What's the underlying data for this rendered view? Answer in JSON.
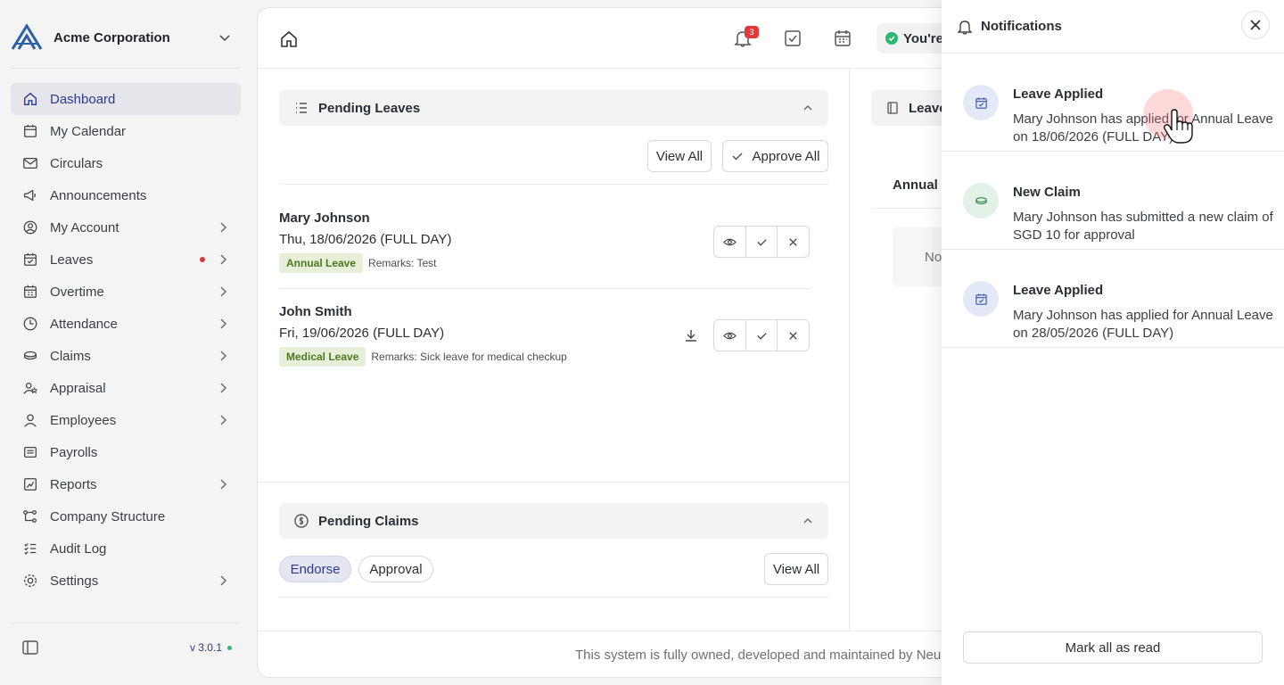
{
  "sidebar": {
    "org_name": "Acme Corporation",
    "version": "v 3.0.1",
    "items": [
      {
        "label": "Dashboard",
        "icon": "home-icon",
        "active": true,
        "chevron": false
      },
      {
        "label": "My Calendar",
        "icon": "calendar-icon",
        "chevron": false
      },
      {
        "label": "Circulars",
        "icon": "mail-icon",
        "chevron": false
      },
      {
        "label": "Announcements",
        "icon": "megaphone-icon",
        "chevron": false
      },
      {
        "label": "My Account",
        "icon": "user-circle-icon",
        "chevron": true
      },
      {
        "label": "Leaves",
        "icon": "calendar-check-icon",
        "chevron": true,
        "dot": true
      },
      {
        "label": "Overtime",
        "icon": "calendar-clock-icon",
        "chevron": true
      },
      {
        "label": "Attendance",
        "icon": "clock-icon",
        "chevron": true
      },
      {
        "label": "Claims",
        "icon": "coins-icon",
        "chevron": true
      },
      {
        "label": "Appraisal",
        "icon": "user-star-icon",
        "chevron": true
      },
      {
        "label": "Employees",
        "icon": "user-icon",
        "chevron": true
      },
      {
        "label": "Payrolls",
        "icon": "receipt-icon",
        "chevron": false
      },
      {
        "label": "Reports",
        "icon": "chart-icon",
        "chevron": true
      },
      {
        "label": "Company Structure",
        "icon": "hierarchy-icon",
        "chevron": false
      },
      {
        "label": "Audit Log",
        "icon": "list-check-icon",
        "chevron": false
      },
      {
        "label": "Settings",
        "icon": "gear-icon",
        "chevron": true
      }
    ]
  },
  "topbar": {
    "notification_count": "3",
    "status_text": "You're"
  },
  "pending_leaves": {
    "title": "Pending Leaves",
    "view_all": "View All",
    "approve_all": "Approve All",
    "items": [
      {
        "name": "Mary Johnson",
        "date": "Thu, 18/06/2026 (FULL DAY)",
        "type": "Annual Leave",
        "remarks": "Remarks: Test"
      },
      {
        "name": "John Smith",
        "date": "Fri, 19/06/2026 (FULL DAY)",
        "type": "Medical Leave",
        "remarks": "Remarks: Sick leave for medical checkup"
      }
    ]
  },
  "pending_claims": {
    "title": "Pending Claims",
    "tab_endorse": "Endorse",
    "tab_approval": "Approval",
    "view_all": "View All"
  },
  "right_panel": {
    "header": "Leave",
    "subheading": "Annual L",
    "empty_text": "No"
  },
  "footer": {
    "text": "This system is fully owned, developed and maintained by Neu"
  },
  "notifications": {
    "title": "Notifications",
    "mark_all": "Mark all as read",
    "items": [
      {
        "title": "Leave Applied",
        "body": "Mary Johnson has applied for Annual Leave on 18/06/2026 (FULL DAY)",
        "icon": "calendar-check-icon",
        "tone": "blue"
      },
      {
        "title": "New Claim",
        "body": "Mary Johnson has submitted a new claim of SGD 10 for approval",
        "icon": "coins-icon",
        "tone": "green"
      },
      {
        "title": "Leave Applied",
        "body": "Mary Johnson has applied for Annual Leave on 28/05/2026 (FULL DAY)",
        "icon": "calendar-check-icon",
        "tone": "blue"
      }
    ]
  },
  "colors": {
    "accent": "#2d3a8c",
    "badge": "#e03a3a",
    "success": "#2bb673",
    "annual_tag": "#e7efd9"
  }
}
